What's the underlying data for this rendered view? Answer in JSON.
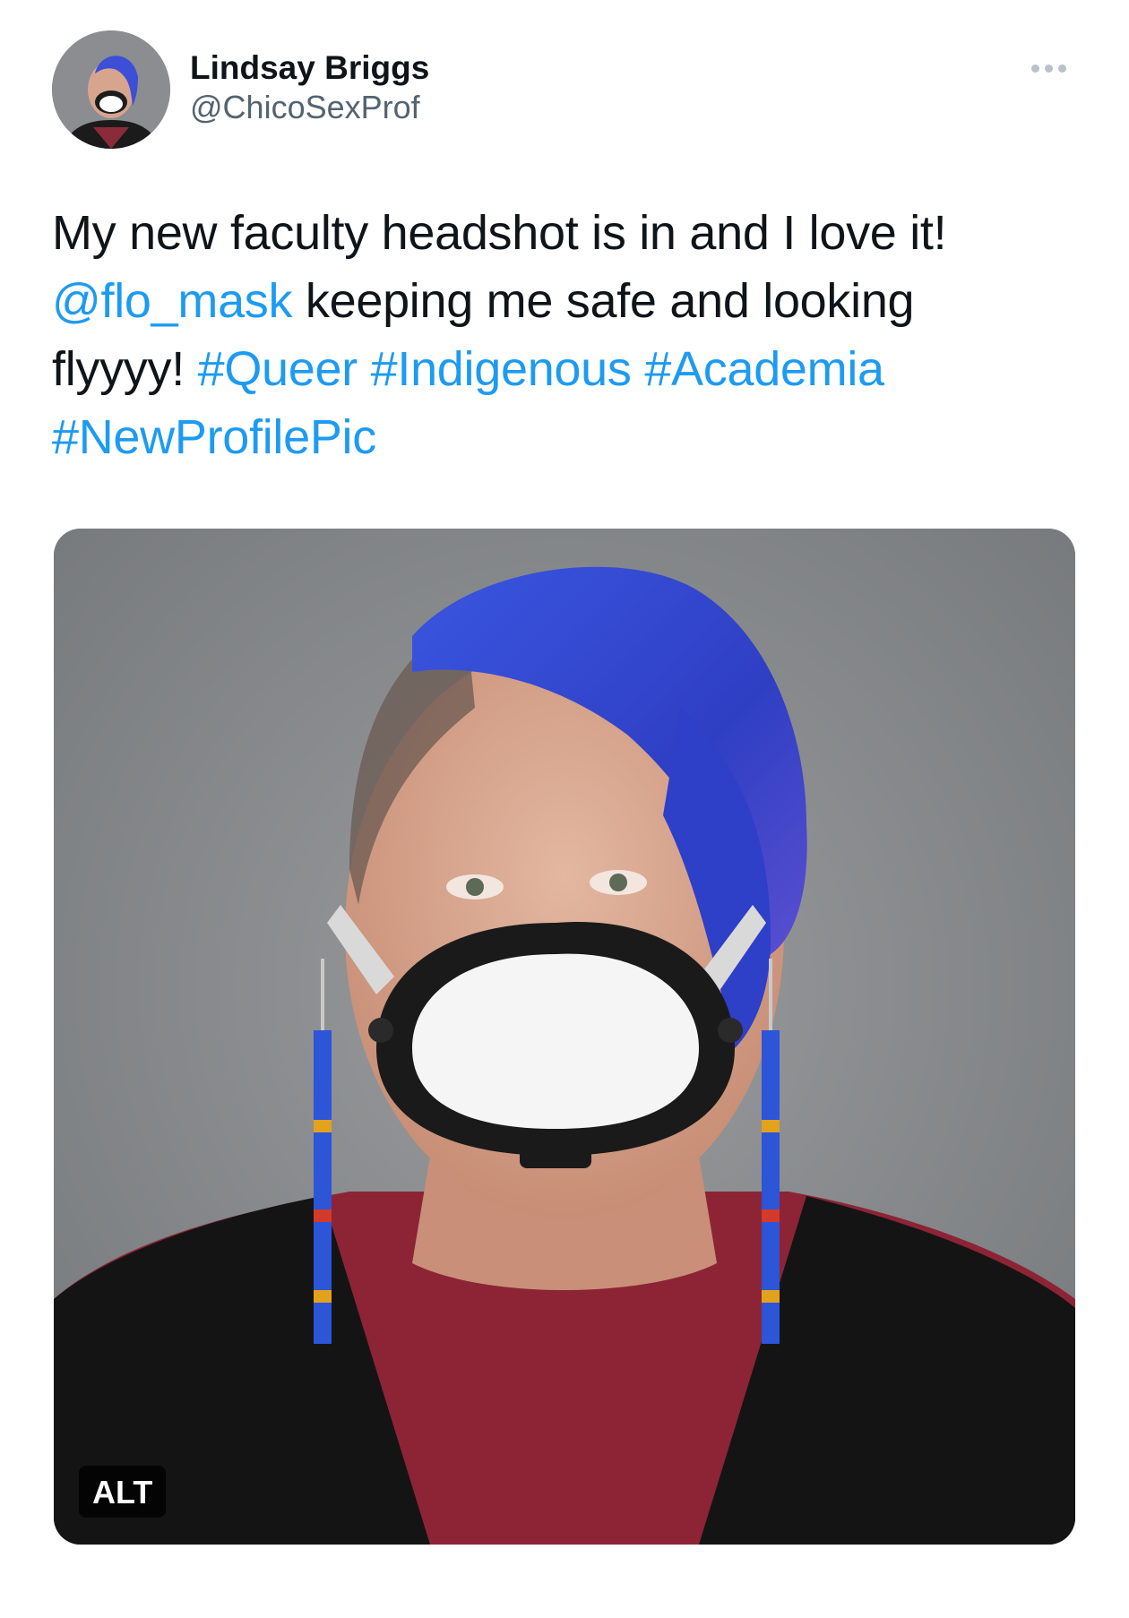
{
  "author": {
    "display_name": "Lindsay Briggs",
    "handle": "@ChicoSexProf"
  },
  "tweet": {
    "line1": "My new faculty headshot is in and I love it!",
    "mention": "@flo_mask",
    "line2_rest": " keeping me safe and looking",
    "line3_start": "flyyyy! ",
    "hashtags": [
      "#Queer",
      "#Indigenous",
      "#Academia",
      "#NewProfilePic"
    ]
  },
  "media": {
    "alt_label": "ALT"
  },
  "icons": {
    "more": "more-horizontal-icon"
  },
  "colors": {
    "link": "#1d9bf0",
    "text": "#0f1419",
    "secondary": "#536471"
  }
}
